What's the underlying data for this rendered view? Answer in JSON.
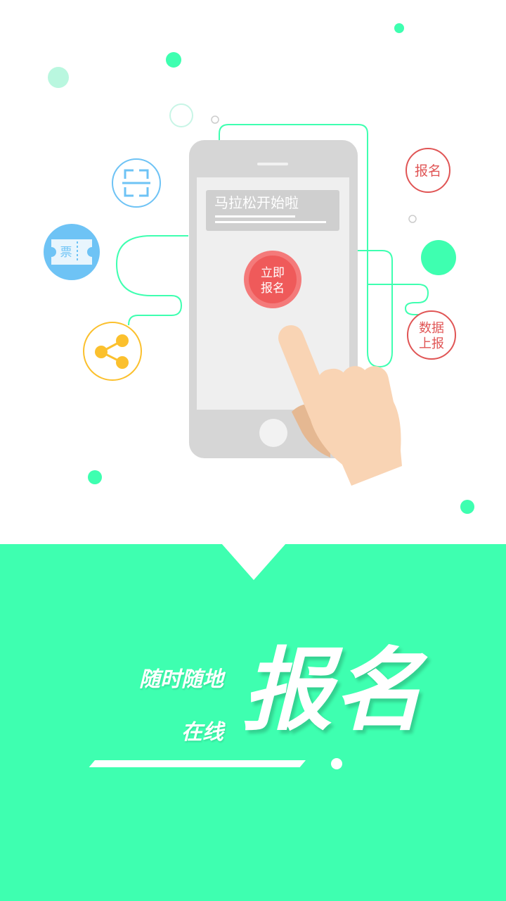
{
  "phone": {
    "notification_title": "马拉松开始啦",
    "cta_line1": "立即",
    "cta_line2": "报名"
  },
  "icons": {
    "ticket_label": "票",
    "register_badge": "报名",
    "data_badge_line1": "数据",
    "data_badge_line2": "上报"
  },
  "slogan": {
    "line1": "随时随地",
    "line2": "在线",
    "big": "报名"
  },
  "colors": {
    "accent": "#3effb0",
    "cta_red": "#f05a5a",
    "ticket_blue": "#6ec3f5",
    "share_yellow": "#fbc02d"
  }
}
